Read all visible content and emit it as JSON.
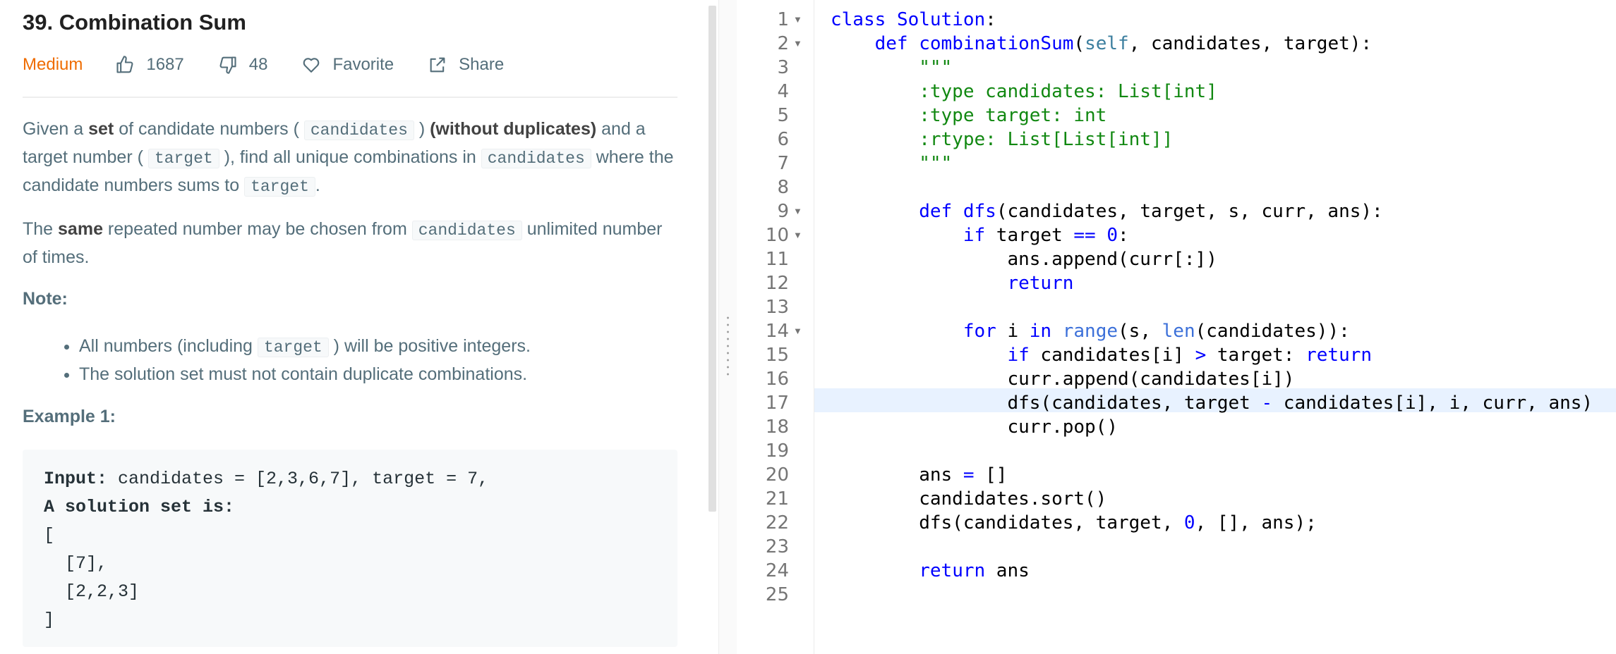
{
  "problem": {
    "title": "39. Combination Sum",
    "difficulty": "Medium",
    "likes": "1687",
    "dislikes": "48",
    "favorite_label": "Favorite",
    "share_label": "Share",
    "p1": {
      "t1": "Given a ",
      "b1": "set",
      "t2": " of candidate numbers ( ",
      "c1": "candidates",
      "t3": " ) ",
      "b2": "(without duplicates)",
      "t4": " and a target number ( ",
      "c2": "target",
      "t5": " ), find all unique combinations in ",
      "c3": "candidates",
      "t6": " where the candidate numbers sums to ",
      "c4": "target",
      "t7": "."
    },
    "p2": {
      "t1": "The ",
      "b1": "same",
      "t2": " repeated number may be chosen from ",
      "c1": "candidates",
      "t3": " unlimited number of times."
    },
    "note_label": "Note:",
    "bullet1": {
      "t1": "All numbers (including ",
      "c1": "target",
      "t2": " ) will be positive integers."
    },
    "bullet2": "The solution set must not contain duplicate combinations.",
    "example_title": "Example 1:",
    "example": {
      "input_label": "Input:",
      "input_value": " candidates = [2,3,6,7], target = 7,",
      "solution_label": "A solution set is:",
      "line3": "[",
      "line4": "  [7],",
      "line5": "  [2,2,3]",
      "line6": "]"
    }
  },
  "editor": {
    "line_numbers": [
      "1",
      "2",
      "3",
      "4",
      "5",
      "6",
      "7",
      "8",
      "9",
      "10",
      "11",
      "12",
      "13",
      "14",
      "15",
      "16",
      "17",
      "18",
      "19",
      "20",
      "21",
      "22",
      "23",
      "24",
      "25"
    ],
    "highlighted_line": "17",
    "code": {
      "l1": [
        "class",
        " ",
        "Solution",
        ":"
      ],
      "l2": [
        "    ",
        "def",
        " ",
        "combinationSum",
        "(",
        "self",
        ", candidates, target):"
      ],
      "l3": "        \"\"\"",
      "l4": "        :type candidates: List[int]",
      "l5": "        :type target: int",
      "l6": "        :rtype: List[List[int]]",
      "l7": "        \"\"\"",
      "l9": [
        "        ",
        "def",
        " ",
        "dfs",
        "(candidates, target, s, curr, ans):"
      ],
      "l10": [
        "            ",
        "if",
        " target ",
        "==",
        " ",
        "0",
        ":"
      ],
      "l11": "                ans.append(curr[:])",
      "l12": [
        "                ",
        "return"
      ],
      "l14": [
        "            ",
        "for",
        " i ",
        "in",
        " ",
        "range",
        "(s, ",
        "len",
        "(candidates)):"
      ],
      "l15": [
        "                ",
        "if",
        " candidates[i] ",
        ">",
        " target: ",
        "return"
      ],
      "l16": "                curr.append(candidates[i])",
      "l17": [
        "                dfs(candidates, target ",
        "-",
        " candidates[i], i, curr, ans)"
      ],
      "l18": "                curr.pop()",
      "l20": [
        "        ans ",
        "=",
        " []"
      ],
      "l21": "        candidates.sort()",
      "l22": [
        "        dfs(candidates, target, ",
        "0",
        ", [], ans);"
      ],
      "l24": [
        "        ",
        "return",
        " ans"
      ]
    }
  }
}
